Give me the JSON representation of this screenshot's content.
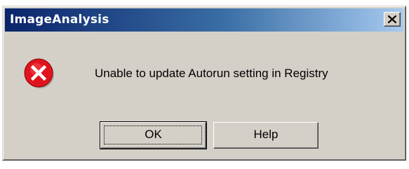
{
  "window": {
    "title": "ImageAnalysis",
    "close_icon": "close-icon"
  },
  "dialog": {
    "icon": "error-icon",
    "icon_color": "#e0141e",
    "message": "Unable to update Autorun setting in Registry"
  },
  "buttons": {
    "ok_label": "OK",
    "help_label": "Help"
  },
  "colors": {
    "title_gradient_start": "#0a246a",
    "title_gradient_end": "#a6caf0",
    "face": "#d4d0c8"
  }
}
